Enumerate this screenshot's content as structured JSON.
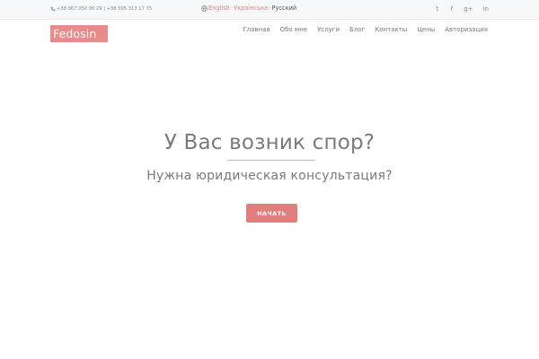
{
  "topbar": {
    "phones": "+38 067 050 00 29 | +38 095 313 17 75",
    "icons": {
      "phone": "phone-icon",
      "globe": "globe-icon"
    },
    "languages": [
      {
        "label": "English",
        "active": false
      },
      {
        "label": "Українська",
        "active": false
      },
      {
        "label": "Русский",
        "active": true
      }
    ],
    "language_separator": "-",
    "socials": [
      {
        "icon": "twitter-icon",
        "glyph": "t"
      },
      {
        "icon": "facebook-icon",
        "glyph": "f"
      },
      {
        "icon": "google-plus-icon",
        "glyph": "g+"
      },
      {
        "icon": "linkedin-icon",
        "glyph": "in"
      }
    ]
  },
  "header": {
    "logo": "Fedosin",
    "nav": [
      "Главная",
      "Обо мне",
      "Услуги",
      "Блог",
      "Контакты",
      "Цены",
      "Авторизация"
    ]
  },
  "hero": {
    "title": "У Вас возник спор?",
    "subtitle": "Нужна юридическая консультация?",
    "cta_label": "НАЧАТЬ"
  },
  "colors": {
    "accent": "#e27d7d",
    "logo_bg": "#e88b8b",
    "topbar_bg": "#f7f8f9",
    "text": "#7a7a7a"
  }
}
